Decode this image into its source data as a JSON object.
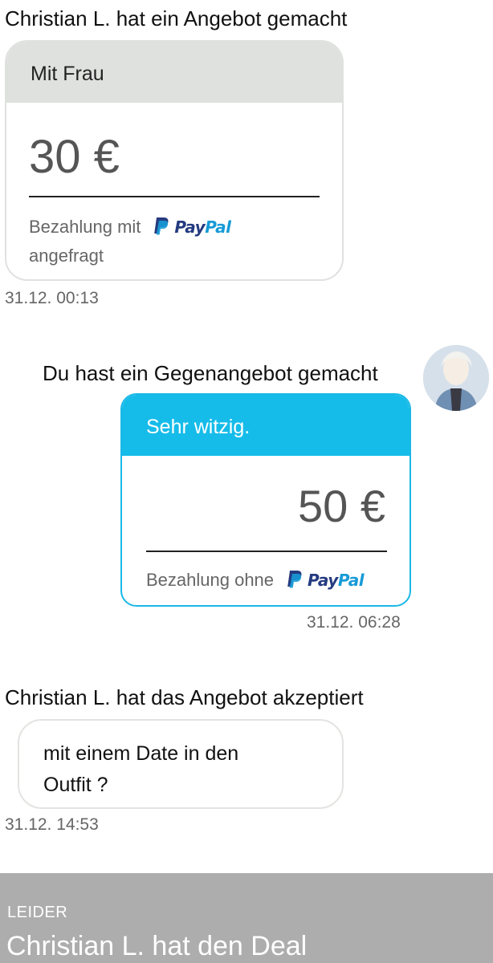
{
  "offer": {
    "event_title": "Christian L. hat ein Angebot gemacht",
    "note": "Mit Frau",
    "amount": "30 €",
    "payment_prefix": "Bezahlung mit",
    "payment_brand_pay": "Pay",
    "payment_brand_pal": "Pal",
    "payment_suffix": "angefragt",
    "timestamp": "31.12. 00:13"
  },
  "counter_offer": {
    "event_title": "Du hast ein Gegenangebot gemacht",
    "note": "Sehr witzig.",
    "amount": "50 €",
    "payment_prefix": "Bezahlung ohne",
    "payment_brand_pay": "Pay",
    "payment_brand_pal": "Pal",
    "timestamp": "31.12. 06:28"
  },
  "accepted": {
    "event_title": "Christian L. hat das Angebot akzeptiert",
    "message_line1": "mit einem Date in den",
    "message_line2": "Outfit ?",
    "timestamp": "31.12. 14:53"
  },
  "footer": {
    "kicker": "LEIDER",
    "headline": "Christian L. hat den Deal"
  },
  "colors": {
    "accent": "#16bce9",
    "paypal_dark": "#253b80",
    "paypal_light": "#179bd7",
    "footer_bg": "#adadad"
  },
  "icons": [
    "paypal-logo-icon",
    "user-avatar"
  ]
}
